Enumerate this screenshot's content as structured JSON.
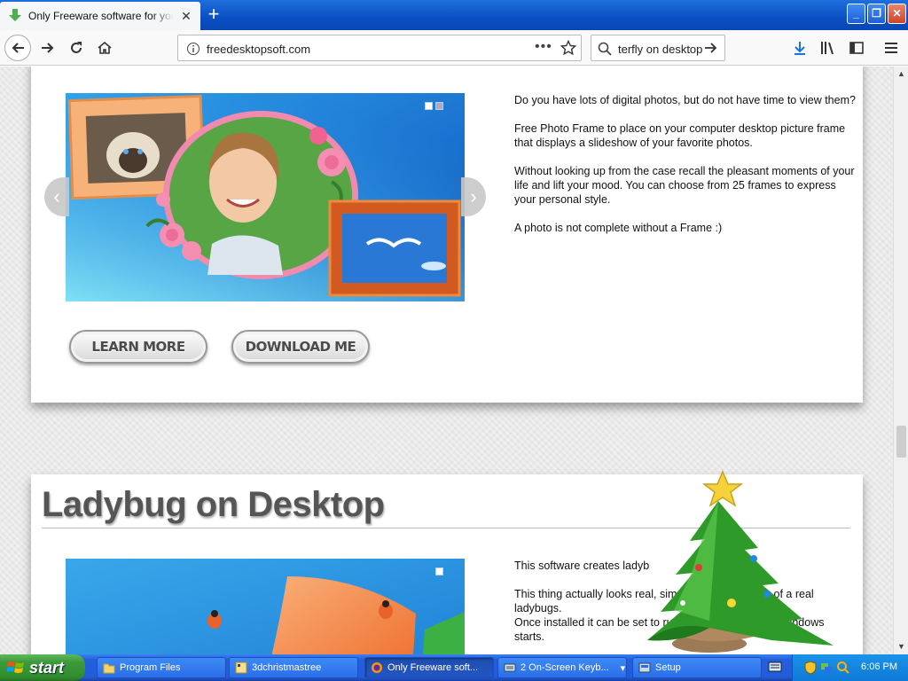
{
  "browser": {
    "tab_title": "Only Freeware software for your desktop",
    "url": "freedesktopsoft.com",
    "search_text": "terfly on desktop",
    "page_actions": "•••"
  },
  "card1": {
    "paragraphs": [
      "Do you have lots of digital photos, but do not have time to view them?",
      "Free Photo Frame to place on your computer desktop picture frame that displays a slideshow of your favorite photos.",
      "Without looking up from the case recall the pleasant moments of your life and lift your mood. You can choose from 25 frames to express your personal style.",
      "A photo is not complete without a Frame :)"
    ],
    "learn_more": "LEARN MORE",
    "download_me": "DOWNLOAD ME"
  },
  "card2": {
    "title": "Ladybug on Desktop",
    "paragraphs": [
      "This software creates ladyb",
      "This thing actually looks real, simulates the behavior of a real ladybugs.",
      "Once installed it can be set to run automatically when Windows starts."
    ]
  },
  "taskbar": {
    "start": "start",
    "tasks": [
      "Program Files",
      "3dchristmastree",
      "Only Freeware soft...",
      "2 On-Screen Keyb...",
      "Setup"
    ],
    "clock": "6:06 PM"
  },
  "colors": {
    "accent": "#0a4fc2",
    "start_green": "#3c9a3a",
    "taskbar_blue": "#245edb"
  }
}
